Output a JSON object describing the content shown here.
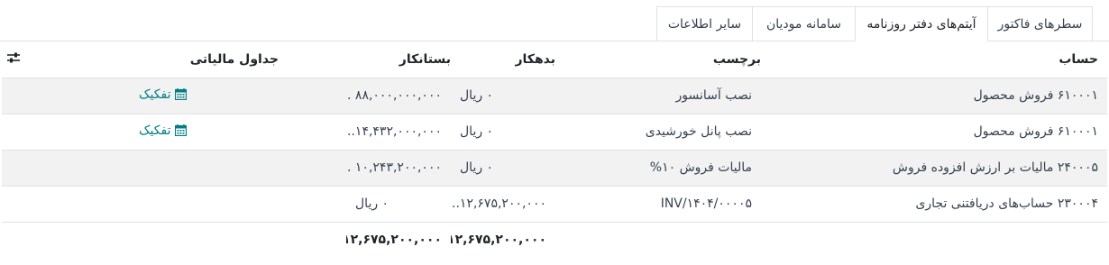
{
  "tabs": [
    {
      "label": "سطرهای فاکتور",
      "active": false
    },
    {
      "label": "آیتم‌های دفتر روزنامه",
      "active": true
    },
    {
      "label": "سامانه مودیان",
      "active": false
    },
    {
      "label": "سایر اطلاعات",
      "active": false
    }
  ],
  "table": {
    "headers": {
      "account": "حساب",
      "label": "برچسب",
      "debit": "بدهکار",
      "credit": "بستانکار",
      "tax_grids": "جداول مالیاتی"
    },
    "rows": [
      {
        "account": "۶۱۰۰۰۱ فروش محصول",
        "label": "نصب آسانسور",
        "debit": "۰ ریال",
        "credit": "۸۸,۰۰۰,۰۰۰,۰۰۰ ...",
        "tax_grids": "تفکیک"
      },
      {
        "account": "۶۱۰۰۰۱ فروش محصول",
        "label": "نصب پانل خورشیدی",
        "debit": "۰ ریال",
        "credit": "۱۴,۴۳۲,۰۰۰,۰۰۰...",
        "tax_grids": "تفکیک"
      },
      {
        "account": "۲۴۰۰۰۵ مالیات بر ارزش افزوده فروش",
        "label": "مالیات فروش ۱۰%",
        "debit": "۰ ریال",
        "credit": "۱۰,۲۴۳,۲۰۰,۰۰۰ ...",
        "tax_grids": ""
      },
      {
        "account": "۲۳۰۰۰۴ حساب‌های دریافتنی تجاری",
        "label": "INV/۱۴۰۴/۰۰۰۰۵",
        "debit": "۱۲,۶۷۵,۲۰۰,۰۰۰...",
        "credit": "۰ ریال",
        "tax_grids": ""
      }
    ],
    "totals": {
      "debit": "۱۲,۶۷۵,۲۰۰,۰۰۰...",
      "credit": "۱۲,۶۷۵,۲۰۰,۰۰۰..."
    }
  },
  "icons": {
    "settings": "sliders-icon",
    "split": "calendar-icon"
  },
  "colors": {
    "link": "#017e84",
    "stripe": "#f2f2f2",
    "border": "#dee2e6"
  }
}
